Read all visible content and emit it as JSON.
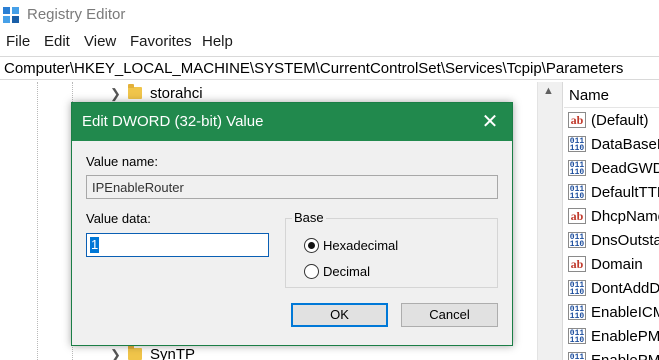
{
  "window": {
    "title": "Registry Editor",
    "icon": "registry-editor-icon"
  },
  "menu": [
    "File",
    "Edit",
    "View",
    "Favorites",
    "Help"
  ],
  "address": "Computer\\HKEY_LOCAL_MACHINE\\SYSTEM\\CurrentControlSet\\Services\\Tcpip\\Parameters",
  "tree": {
    "items": [
      {
        "label": "storahci",
        "icon": "folder-icon",
        "expander": "chevron-right-icon"
      },
      {
        "label": "SynTP",
        "icon": "folder-icon",
        "expander": "chevron-right-icon"
      }
    ]
  },
  "values": {
    "header": "Name",
    "items": [
      {
        "name": "(Default)",
        "type_icon": "string-value-icon",
        "icon_text": "ab"
      },
      {
        "name": "DataBaseP",
        "type_icon": "dword-value-icon",
        "icon_text": "011\n110"
      },
      {
        "name": "DeadGWD",
        "type_icon": "dword-value-icon",
        "icon_text": "011\n110"
      },
      {
        "name": "DefaultTTL",
        "type_icon": "dword-value-icon",
        "icon_text": "011\n110"
      },
      {
        "name": "DhcpName",
        "type_icon": "string-value-icon",
        "icon_text": "ab"
      },
      {
        "name": "DnsOutsta",
        "type_icon": "dword-value-icon",
        "icon_text": "011\n110"
      },
      {
        "name": "Domain",
        "type_icon": "string-value-icon",
        "icon_text": "ab"
      },
      {
        "name": "DontAddD",
        "type_icon": "dword-value-icon",
        "icon_text": "011\n110"
      },
      {
        "name": "EnableICM",
        "type_icon": "dword-value-icon",
        "icon_text": "011\n110"
      },
      {
        "name": "EnablePMT",
        "type_icon": "dword-value-icon",
        "icon_text": "011\n110"
      },
      {
        "name": "EnablePMT",
        "type_icon": "dword-value-icon",
        "icon_text": "011\n110"
      }
    ]
  },
  "dialog": {
    "title": "Edit DWORD (32-bit) Value",
    "close": "✕",
    "value_name_label": "Value name:",
    "value_name": "IPEnableRouter",
    "value_data_label": "Value data:",
    "value_data": "1",
    "base_label": "Base",
    "base_options": [
      {
        "label": "Hexadecimal",
        "selected": true
      },
      {
        "label": "Decimal",
        "selected": false
      }
    ],
    "ok": "OK",
    "cancel": "Cancel"
  },
  "colors": {
    "dialog_accent": "#21894d",
    "selection": "#0078d7"
  }
}
